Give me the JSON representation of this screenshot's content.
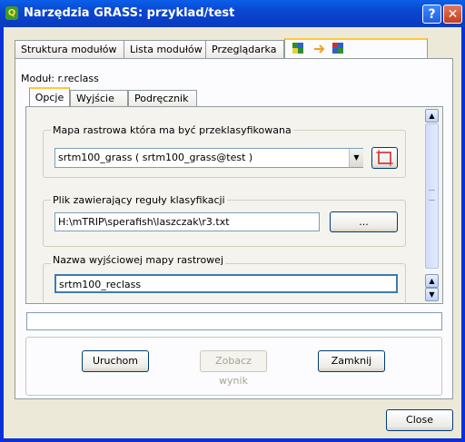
{
  "window": {
    "title": "Narzędzia GRASS: przyklad/test"
  },
  "outer_tabs": [
    "Struktura modułów",
    "Lista modułów",
    "Przeglądarka"
  ],
  "module_label": "Moduł: r.reclass",
  "inner_tabs": [
    "Opcje",
    "Wyjście",
    "Podręcznik"
  ],
  "options": {
    "input_map": {
      "label": "Mapa rastrowa która ma być przeklasyfikowana",
      "value": "srtm100_grass ( srtm100_grass@test )"
    },
    "rules_file": {
      "label": "Plik zawierający reguły klasyfikacji",
      "value": "H:\\mTRIP\\sperafish\\laszczak\\r3.txt",
      "browse_label": "..."
    },
    "output_map": {
      "label": "Nazwa wyjściowej mapy rastrowej",
      "value": "srtm100_reclass"
    }
  },
  "status_value": "",
  "buttons": {
    "run": "Uruchom",
    "view": "Zobacz wynik",
    "close_module": "Zamknij",
    "close_dialog": "Close"
  },
  "colors": {
    "titlebar": "#0a47d1",
    "dialog_bg": "#ece9d8",
    "tab_highlight": "#ffc83c",
    "input_border": "#7f9db9",
    "output_focus": "#3d7bad"
  }
}
